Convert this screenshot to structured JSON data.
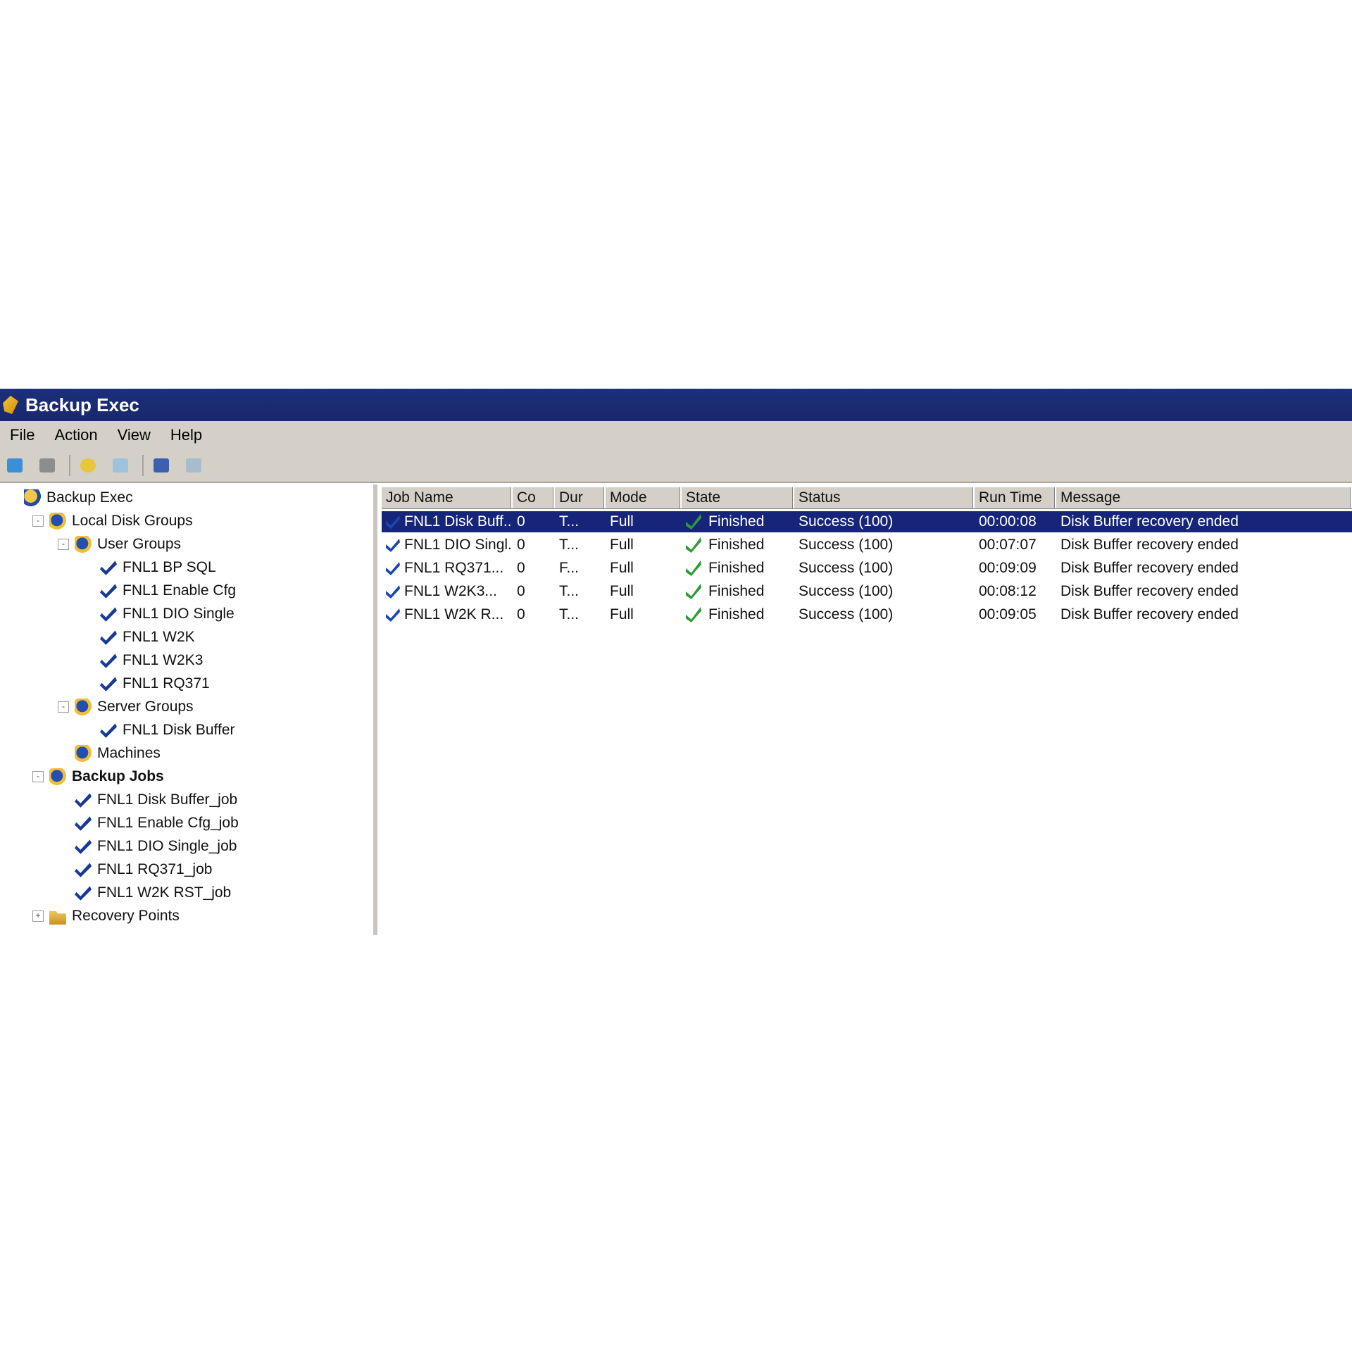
{
  "window": {
    "title": "Backup Exec",
    "accent_color": "#1b2f7c"
  },
  "menu": [
    "File",
    "Action",
    "View",
    "Help"
  ],
  "toolbar": {
    "buttons": [
      "back-icon",
      "forward-icon",
      "up-icon",
      "edit-icon",
      "properties-icon",
      "help-icon"
    ]
  },
  "tree": [
    {
      "label": "Backup Exec",
      "level": 0,
      "icon": "root",
      "expander": "none",
      "bold": false
    },
    {
      "label": "Local Disk Groups",
      "level": 1,
      "icon": "group",
      "expander": "-",
      "bold": false
    },
    {
      "label": "User Groups",
      "level": 2,
      "icon": "group",
      "expander": "-",
      "bold": false
    },
    {
      "label": "FNL1 BP SQL",
      "level": 3,
      "icon": "check",
      "expander": "none",
      "bold": false
    },
    {
      "label": "FNL1 Enable Cfg",
      "level": 3,
      "icon": "check",
      "expander": "none",
      "bold": false
    },
    {
      "label": "FNL1 DIO Single",
      "level": 3,
      "icon": "check",
      "expander": "none",
      "bold": false
    },
    {
      "label": "FNL1 W2K",
      "level": 3,
      "icon": "check",
      "expander": "none",
      "bold": false
    },
    {
      "label": "FNL1 W2K3",
      "level": 3,
      "icon": "check",
      "expander": "none",
      "bold": false
    },
    {
      "label": "FNL1 RQ371",
      "level": 3,
      "icon": "check",
      "expander": "none",
      "bold": false
    },
    {
      "label": "Server Groups",
      "level": 2,
      "icon": "group",
      "expander": "-",
      "bold": false
    },
    {
      "label": "FNL1 Disk Buffer",
      "level": 3,
      "icon": "check",
      "expander": "none",
      "bold": false
    },
    {
      "label": "Machines",
      "level": 2,
      "icon": "group",
      "expander": "none",
      "bold": false
    },
    {
      "label": "Backup Jobs",
      "level": 1,
      "icon": "group",
      "expander": "-",
      "bold": true
    },
    {
      "label": "FNL1 Disk Buffer_job",
      "level": 2,
      "icon": "check",
      "expander": "none",
      "bold": false
    },
    {
      "label": "FNL1 Enable Cfg_job",
      "level": 2,
      "icon": "check",
      "expander": "none",
      "bold": false
    },
    {
      "label": "FNL1 DIO Single_job",
      "level": 2,
      "icon": "check",
      "expander": "none",
      "bold": false
    },
    {
      "label": "FNL1 RQ371_job",
      "level": 2,
      "icon": "check",
      "expander": "none",
      "bold": false
    },
    {
      "label": "FNL1 W2K RST_job",
      "level": 2,
      "icon": "check",
      "expander": "none",
      "bold": false
    },
    {
      "label": "Recovery Points",
      "level": 1,
      "icon": "folder",
      "expander": "+",
      "bold": false
    }
  ],
  "table": {
    "columns": [
      "Job Name",
      "Co",
      "Dur",
      "Mode",
      "State",
      "Status",
      "Run Time",
      "Message"
    ],
    "rows": [
      [
        "FNL1 Disk Buff...",
        "0",
        "T...",
        "Full",
        "Finished",
        "Success (100)",
        "00:00:08",
        "Disk Buffer recovery ended"
      ],
      [
        "FNL1 DIO Singl...",
        "0",
        "T...",
        "Full",
        "Finished",
        "Success (100)",
        "00:07:07",
        "Disk Buffer recovery ended"
      ],
      [
        "FNL1 RQ371...",
        "0",
        "F...",
        "Full",
        "Finished",
        "Success (100)",
        "00:09:09",
        "Disk Buffer recovery ended"
      ],
      [
        "FNL1 W2K3...",
        "0",
        "T...",
        "Full",
        "Finished",
        "Success (100)",
        "00:08:12",
        "Disk Buffer recovery ended"
      ],
      [
        "FNL1 W2K R...",
        "0",
        "T...",
        "Full",
        "Finished",
        "Success (100)",
        "00:09:05",
        "Disk Buffer recovery ended"
      ]
    ],
    "selected_row": 0
  }
}
